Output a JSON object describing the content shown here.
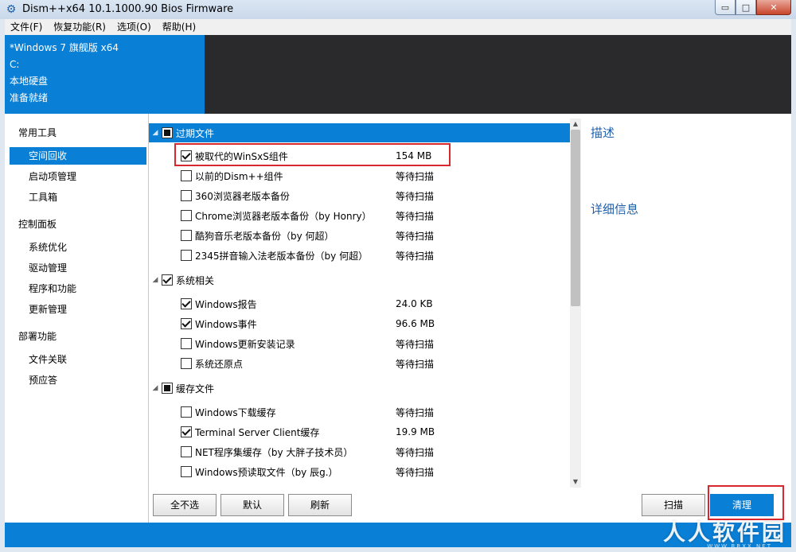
{
  "window": {
    "title": "Dism++x64 10.1.1000.90 Bios Firmware",
    "app_icon": "gear-icon",
    "buttons": {
      "minimize": "▭",
      "maximize": "□",
      "close": "✕"
    }
  },
  "menu": [
    "文件(F)",
    "恢复功能(R)",
    "选项(O)",
    "帮助(H)"
  ],
  "session": {
    "os": "*Windows 7 旗舰版 x64",
    "drive": "C:",
    "disk": "本地硬盘",
    "status": "准备就绪"
  },
  "nav": {
    "groups": [
      "常用工具",
      "控制面板",
      "部署功能"
    ],
    "items": [
      "空间回收",
      "启动项管理",
      "工具箱",
      "系统优化",
      "驱动管理",
      "程序和功能",
      "更新管理",
      "文件关联",
      "预应答"
    ]
  },
  "list": {
    "groups": [
      {
        "label": "过期文件",
        "state": "partial"
      },
      {
        "label": "系统相关",
        "state": "checked"
      },
      {
        "label": "缓存文件",
        "state": "partial"
      }
    ],
    "items": [
      {
        "label": "被取代的WinSxS组件",
        "size": "154 MB",
        "checked": true
      },
      {
        "label": "以前的Dism++组件",
        "size": "等待扫描",
        "checked": false
      },
      {
        "label": "360浏览器老版本备份",
        "size": "等待扫描",
        "checked": false
      },
      {
        "label": "Chrome浏览器老版本备份（by Honry）",
        "size": "等待扫描",
        "checked": false
      },
      {
        "label": "酷狗音乐老版本备份（by 何超）",
        "size": "等待扫描",
        "checked": false
      },
      {
        "label": "2345拼音输入法老版本备份（by 何超）",
        "size": "等待扫描",
        "checked": false
      },
      {
        "label": "Windows报告",
        "size": "24.0 KB",
        "checked": true
      },
      {
        "label": "Windows事件",
        "size": "96.6 MB",
        "checked": true
      },
      {
        "label": "Windows更新安装记录",
        "size": "等待扫描",
        "checked": false
      },
      {
        "label": "系统还原点",
        "size": "等待扫描",
        "checked": false
      },
      {
        "label": "Windows下载缓存",
        "size": "等待扫描",
        "checked": false
      },
      {
        "label": "Terminal Server Client缓存",
        "size": "19.9 MB",
        "checked": true
      },
      {
        "label": "NET程序集缓存（by 大胖子技术员）",
        "size": "等待扫描",
        "checked": false
      },
      {
        "label": "Windows预读取文件（by 辰g.）",
        "size": "等待扫描",
        "checked": false
      }
    ]
  },
  "details": {
    "description_title": "描述",
    "details_title": "详细信息"
  },
  "buttons": {
    "select_none": "全不选",
    "default": "默认",
    "refresh": "刷新",
    "scan": "扫描",
    "clean": "清理"
  },
  "watermark": {
    "brand": "人人软件园",
    "url": "WWW.RRXX.NET"
  },
  "colors": {
    "accent": "#0a7fd6",
    "dark_header": "#2a2a2c",
    "highlight": "#d9272e",
    "link_text": "#1f5fa8"
  }
}
